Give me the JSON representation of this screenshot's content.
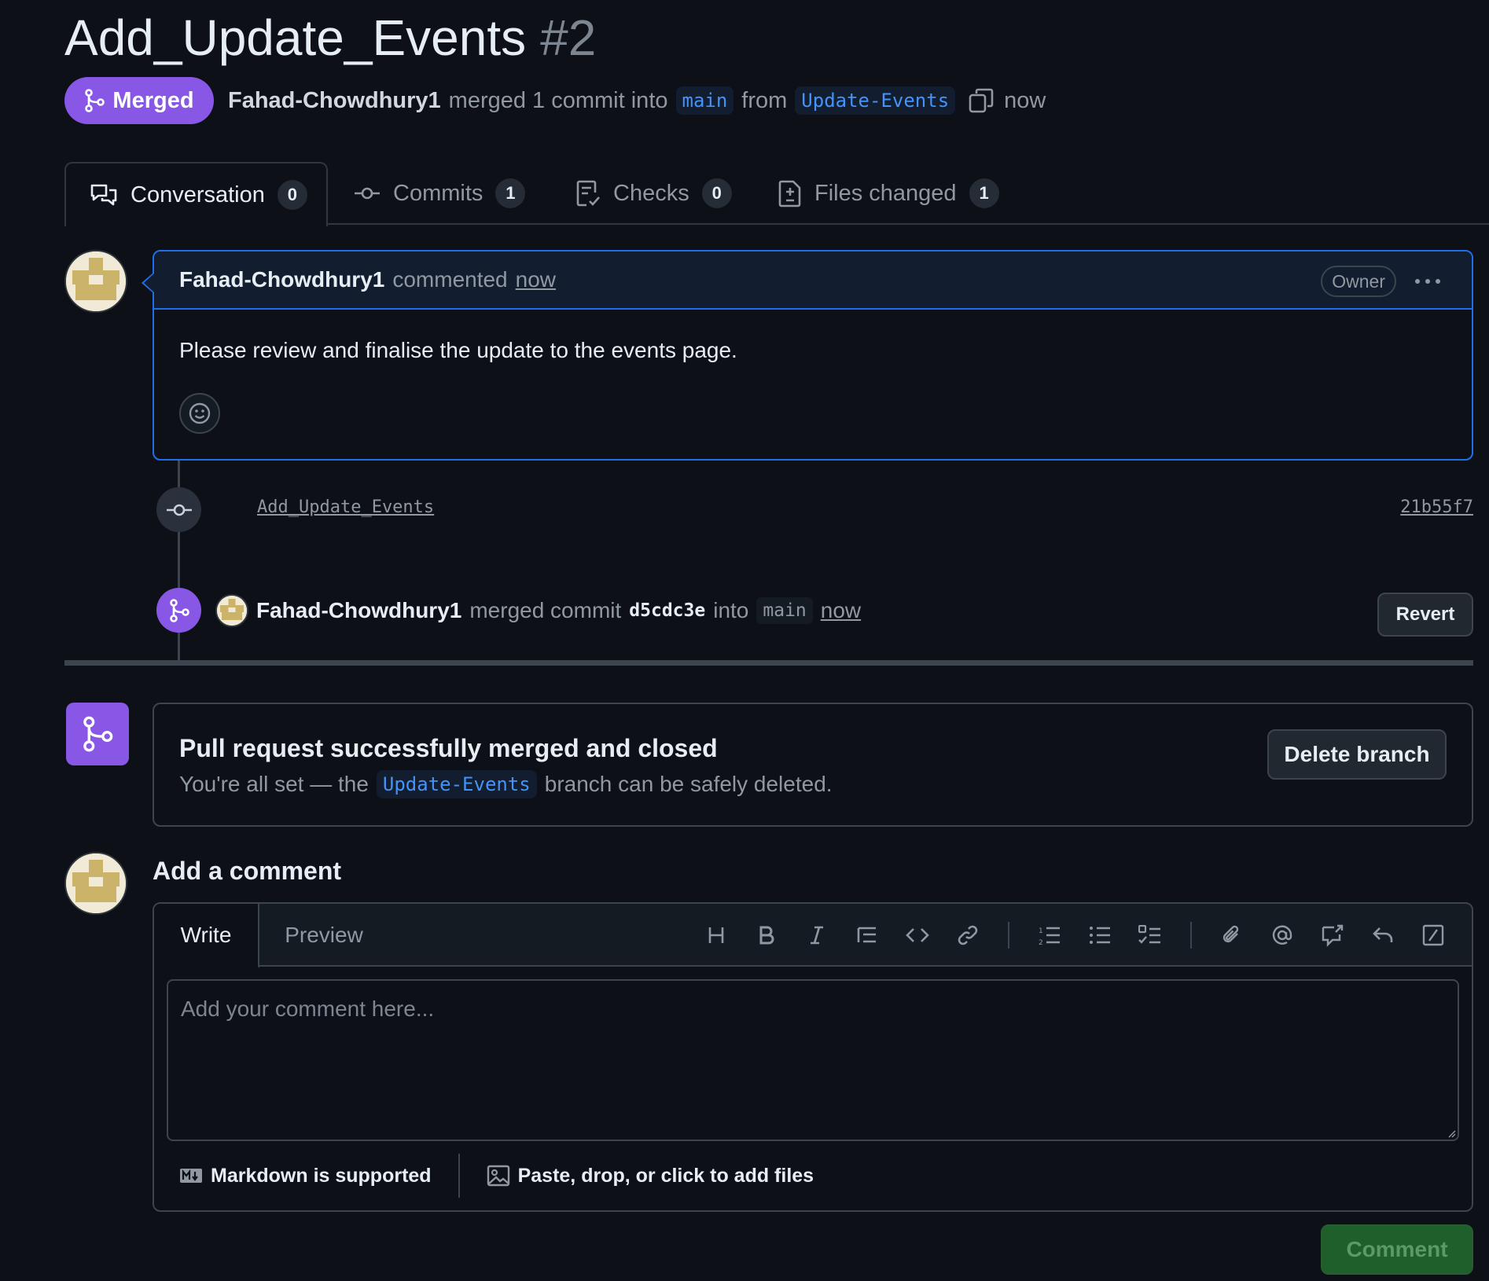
{
  "pr": {
    "title": "Add_Update_Events",
    "number": "#2",
    "state_label": "Merged",
    "author": "Fahad-Chowdhury1",
    "merge_text": "merged 1 commit into",
    "base_branch": "main",
    "from_text": "from",
    "head_branch": "Update-Events",
    "time": "now"
  },
  "tabs": [
    {
      "label": "Conversation",
      "count": "0",
      "icon": "comment-discussion-icon"
    },
    {
      "label": "Commits",
      "count": "1",
      "icon": "git-commit-icon"
    },
    {
      "label": "Checks",
      "count": "0",
      "icon": "checklist-icon"
    },
    {
      "label": "Files changed",
      "count": "1",
      "icon": "file-diff-icon"
    }
  ],
  "comment": {
    "author": "Fahad-Chowdhury1",
    "action": "commented",
    "time": "now",
    "badge": "Owner",
    "body": "Please review and finalise the update to the events page."
  },
  "timeline": {
    "commit_message": "Add_Update_Events",
    "commit_sha": "21b55f7",
    "merge_author": "Fahad-Chowdhury1",
    "merge_text": "merged commit",
    "merge_sha": "d5cdc3e",
    "into_text": "into",
    "merge_branch": "main",
    "merge_time": "now",
    "revert_label": "Revert"
  },
  "merged_box": {
    "title": "Pull request successfully merged and closed",
    "sub_prefix": "You're all set — the",
    "branch": "Update-Events",
    "sub_suffix": "branch can be safely deleted.",
    "delete_label": "Delete branch"
  },
  "editor": {
    "heading": "Add a comment",
    "write_tab": "Write",
    "preview_tab": "Preview",
    "placeholder": "Add your comment here...",
    "markdown_note": "Markdown is supported",
    "files_note": "Paste, drop, or click to add files",
    "submit_label": "Comment",
    "toolbar": [
      "heading-icon",
      "bold-icon",
      "italic-icon",
      "quote-icon",
      "code-icon",
      "link-icon",
      "ordered-list-icon",
      "unordered-list-icon",
      "task-list-icon",
      "attach-icon",
      "mention-icon",
      "reference-icon",
      "undo-icon",
      "slash-command-icon"
    ]
  },
  "colors": {
    "background": "#0d1117",
    "merged_purple": "#8957e5",
    "link_blue": "#4493f8",
    "border": "#3d444d",
    "comment_button_green": "#1f5f2c"
  }
}
